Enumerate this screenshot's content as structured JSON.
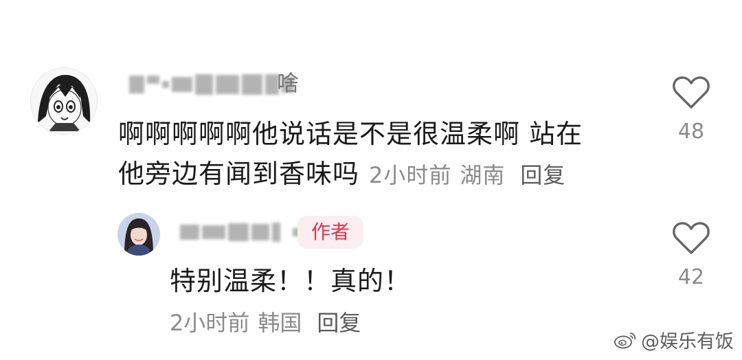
{
  "comments": [
    {
      "name_tail": "啥",
      "text_line1": "啊啊啊啊啊他说话是不是很温柔啊 站在",
      "text_line2": "他旁边有闻到香味吗",
      "time": "2小时前",
      "location": "湖南",
      "reply_label": "回复",
      "likes": "48"
    },
    {
      "badge": "作者",
      "text": "特别温柔！！真的！",
      "time": "2小时前",
      "location": "韩国",
      "reply_label": "回复",
      "likes": "42"
    }
  ],
  "watermark": "@娱乐有饭",
  "colors": {
    "badge_bg": "#fbeef0",
    "badge_text": "#e0334f",
    "meta_text": "#8a8a8a"
  }
}
